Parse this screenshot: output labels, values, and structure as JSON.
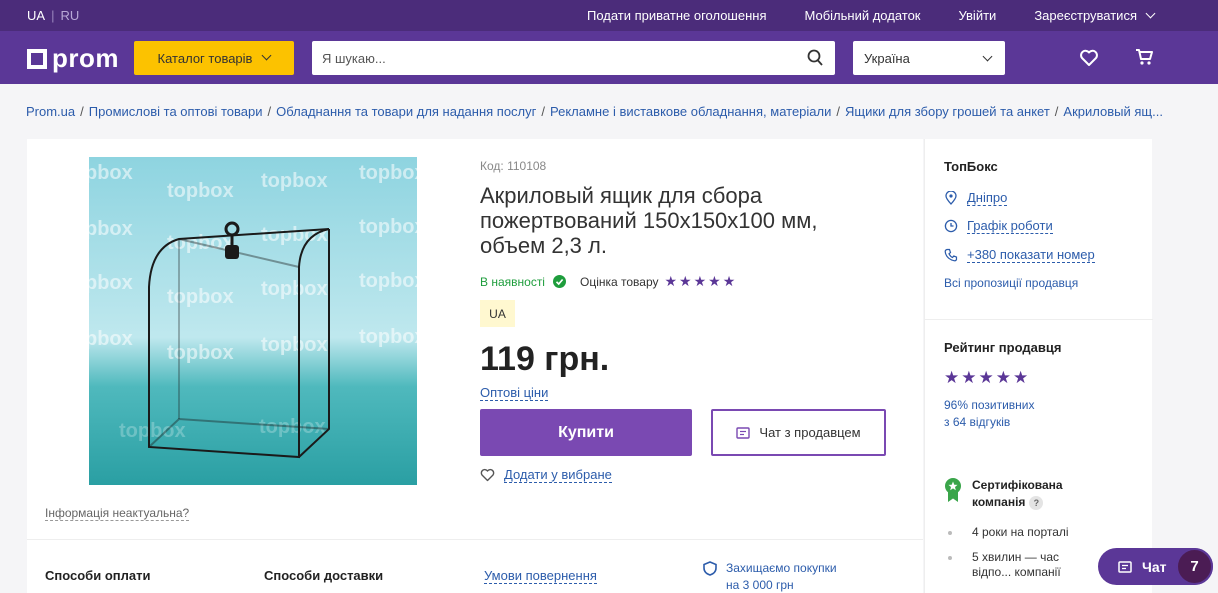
{
  "topbar": {
    "lang_ua": "UA",
    "lang_sep": "|",
    "lang_ru": "RU",
    "links": [
      "Подати приватне оголошення",
      "Мобільний додаток",
      "Увійти",
      "Зареєструватися"
    ]
  },
  "header": {
    "logo": "prom",
    "catalog_label": "Каталог товарів",
    "search_placeholder": "Я шукаю...",
    "region": "Україна"
  },
  "breadcrumbs": [
    "Prom.ua",
    "Промислові та оптові товари",
    "Обладнання та товари для надання послуг",
    "Рекламне і виставкове обладнання, матеріали",
    "Ящики для збору грошей та анкет",
    "Акриловый ящ..."
  ],
  "breadcrumb_sep": "/",
  "product": {
    "image_watermark": "topbox.com.ua",
    "info_link": "Інформація неактуальна?",
    "code": "Код: 110108",
    "title": "Акриловый ящик для сбора пожертвований 150х150х100 мм, объем 2,3 л.",
    "in_stock": "В наявності",
    "rating_label": "Оцінка товару",
    "stars": "★★★★★",
    "badge": "UA",
    "price": "119 грн.",
    "wholesale": "Оптові ціни",
    "buy": "Купити",
    "chat_seller": "Чат з продавцем",
    "add_fav": "Додати у вибране"
  },
  "bottom": {
    "payment": "Способи оплати",
    "delivery": "Способи доставки",
    "returns": "Умови повернення",
    "protect_line1": "Захищаємо покупки",
    "protect_line2": "на 3 000 грн"
  },
  "seller": {
    "name": "ТопБокс",
    "city": "Дніпро",
    "schedule": "Графік роботи",
    "phone": "+380 показати номер",
    "all_offers": "Всі пропозиції продавця",
    "rating_head": "Рейтинг продавця",
    "stars": "★★★★★",
    "positive_line1": "96% позитивних",
    "positive_line2": "з 64 відгуків",
    "cert_line1": "Сертифікована",
    "cert_line2": "компанія",
    "cert_q": "?",
    "facts": [
      "4 роки на порталі",
      "5 хвилин — час відпо... компанії"
    ]
  },
  "chat_widget": {
    "label": "Чат",
    "count": "7"
  },
  "colors": {
    "brand_purple": "#5b3797",
    "topbar": "#4b2c7a",
    "catalog_yellow": "#fcc200",
    "button_purple": "#7a49b2",
    "link_blue": "#2c5cab",
    "in_stock_green": "#1e9d3c"
  }
}
